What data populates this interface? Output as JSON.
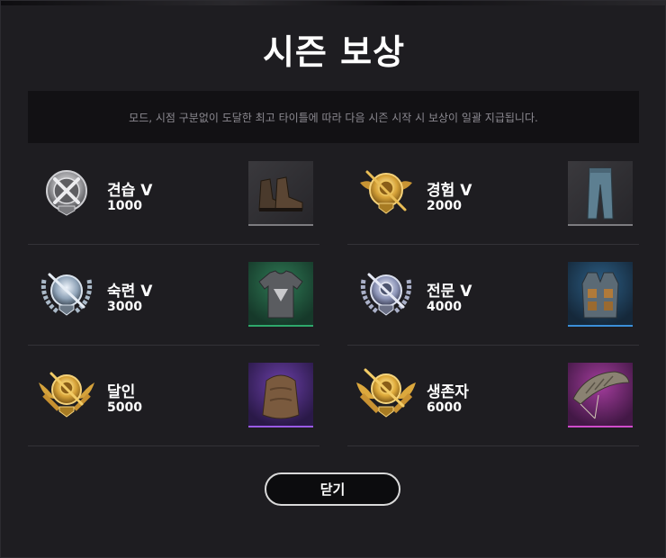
{
  "title": "시즌 보상",
  "notice": "모드, 시점 구분없이 도달한 최고 타이틀에 따라 다음 시즌 시작 시 보상이 일괄 지급됩니다.",
  "tiers": [
    {
      "name": "견습 V",
      "points": "1000",
      "medal": "silver-medal-icon",
      "reward": "boots-icon",
      "rarity_color": "#7d7c80"
    },
    {
      "name": "경험 V",
      "points": "2000",
      "medal": "gold-medal-icon",
      "reward": "jeans-icon",
      "rarity_color": "#7d7c80"
    },
    {
      "name": "숙련 V",
      "points": "3000",
      "medal": "silver-wreath-medal-icon",
      "reward": "tshirt-icon",
      "rarity_color": "#2ea86b"
    },
    {
      "name": "전문 V",
      "points": "4000",
      "medal": "silver-wreath-medal-icon",
      "reward": "vest-icon",
      "rarity_color": "#3b8fd8"
    },
    {
      "name": "달인",
      "points": "5000",
      "medal": "gold-wreath-medal-icon",
      "reward": "backpack-icon",
      "rarity_color": "#9a5ae6"
    },
    {
      "name": "생존자",
      "points": "6000",
      "medal": "gold-wreath-medal-icon",
      "reward": "parachute-icon",
      "rarity_color": "#d04ccb"
    }
  ],
  "close_label": "닫기"
}
